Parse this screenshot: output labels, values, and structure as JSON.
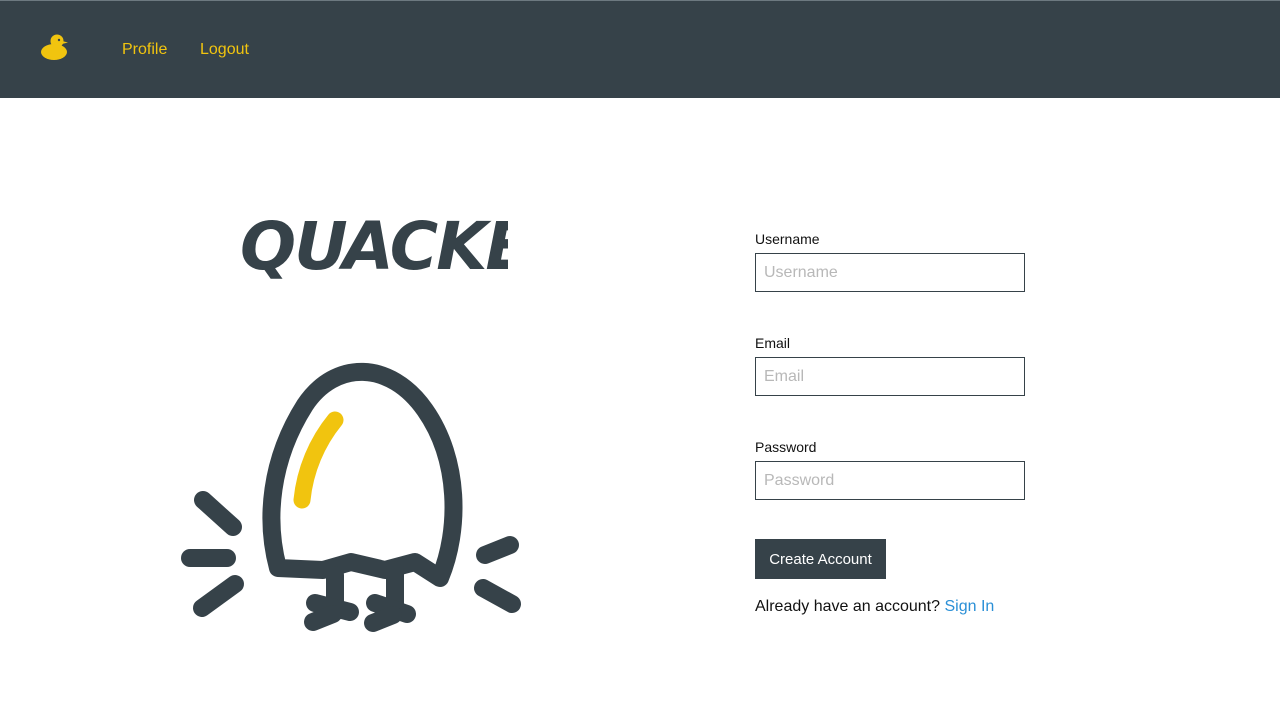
{
  "navbar": {
    "logo_icon": "duck-icon",
    "links": [
      {
        "label": "Profile"
      },
      {
        "label": "Logout"
      }
    ],
    "background": "#364249",
    "link_color": "#f1c40f"
  },
  "brand": {
    "title": "QUACKER.",
    "illustration_icon": "egg-with-legs-icon",
    "accent_color": "#f1c40f",
    "ink_color": "#364249"
  },
  "form": {
    "username": {
      "label": "Username",
      "placeholder": "Username",
      "value": ""
    },
    "email": {
      "label": "Email",
      "placeholder": "Email",
      "value": ""
    },
    "password": {
      "label": "Password",
      "placeholder": "Password",
      "value": ""
    },
    "submit_label": "Create Account",
    "signin_prompt": "Already have an account?",
    "signin_link": "Sign In",
    "link_color": "#2a8fd6"
  }
}
